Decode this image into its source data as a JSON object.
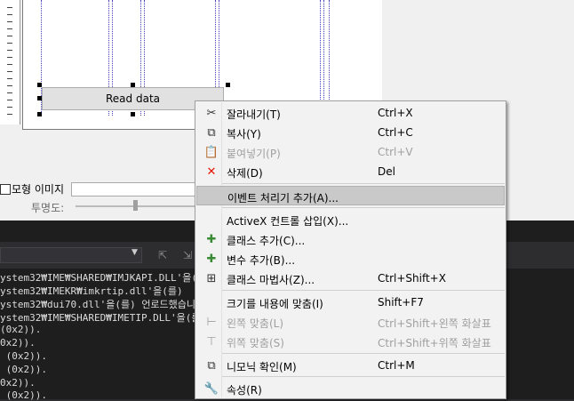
{
  "designer": {
    "button_label": "Read data"
  },
  "properties": {
    "image_label": "모형 이미지",
    "opacity_label": "투명도:",
    "opacity_value": 0.5
  },
  "output": {
    "lines": [
      "ystem32₩IME₩SHARED₩IMJKAPI.DLL'을(를)",
      "ystem32₩IMEKR₩imkrtip.dll'을(를)",
      "ystem32₩dui70.dll'을(를) 언로드했습니",
      "ystem32₩IME₩SHARED₩IMETIP.DLL'을(를)",
      "(0x2)).",
      "0x2)).",
      " (0x2)).",
      " (0x2)).",
      "0x2)).",
      " (0x2))."
    ]
  },
  "context_menu": {
    "items": [
      {
        "icon": "scissors-icon",
        "label": "잘라내기(T)",
        "shortcut": "Ctrl+X",
        "disabled": false
      },
      {
        "icon": "copy-icon",
        "label": "복사(Y)",
        "shortcut": "Ctrl+C",
        "disabled": false
      },
      {
        "icon": "paste-icon",
        "label": "붙여넣기(P)",
        "shortcut": "Ctrl+V",
        "disabled": true
      },
      {
        "icon": "delete-icon",
        "label": "삭제(D)",
        "shortcut": "Del",
        "disabled": false
      },
      {
        "icon": "",
        "label": "이벤트 처리기 추가(A)...",
        "shortcut": "",
        "disabled": false,
        "highlighted": true
      },
      {
        "icon": "",
        "label": "ActiveX 컨트롤 삽입(X)...",
        "shortcut": "",
        "disabled": false
      },
      {
        "icon": "add-class-icon",
        "label": "클래스 추가(C)...",
        "shortcut": "",
        "disabled": false
      },
      {
        "icon": "add-variable-icon",
        "label": "변수 추가(B)...",
        "shortcut": "",
        "disabled": false
      },
      {
        "icon": "class-wizard-icon",
        "label": "클래스 마법사(Z)...",
        "shortcut": "Ctrl+Shift+X",
        "disabled": false
      },
      {
        "icon": "",
        "label": "크기를 내용에 맞춤(I)",
        "shortcut": "Shift+F7",
        "disabled": false
      },
      {
        "icon": "align-left-icon",
        "label": "왼쪽 맞춤(L)",
        "shortcut": "Ctrl+Shift+왼쪽 화살표",
        "disabled": true
      },
      {
        "icon": "align-top-icon",
        "label": "위쪽 맞춤(S)",
        "shortcut": "Ctrl+Shift+위쪽 화살표",
        "disabled": true
      },
      {
        "icon": "mnemonics-icon",
        "label": "니모닉 확인(M)",
        "shortcut": "Ctrl+M",
        "disabled": false
      },
      {
        "icon": "wrench-icon",
        "label": "속성(R)",
        "shortcut": "",
        "disabled": false
      }
    ]
  },
  "colors": {
    "menu_bg": "#f2f2f2",
    "highlight": "#c9c9c9",
    "delete_icon": "#e51400",
    "add_icon": "#388a34",
    "output_bg": "#1e1e1e"
  }
}
